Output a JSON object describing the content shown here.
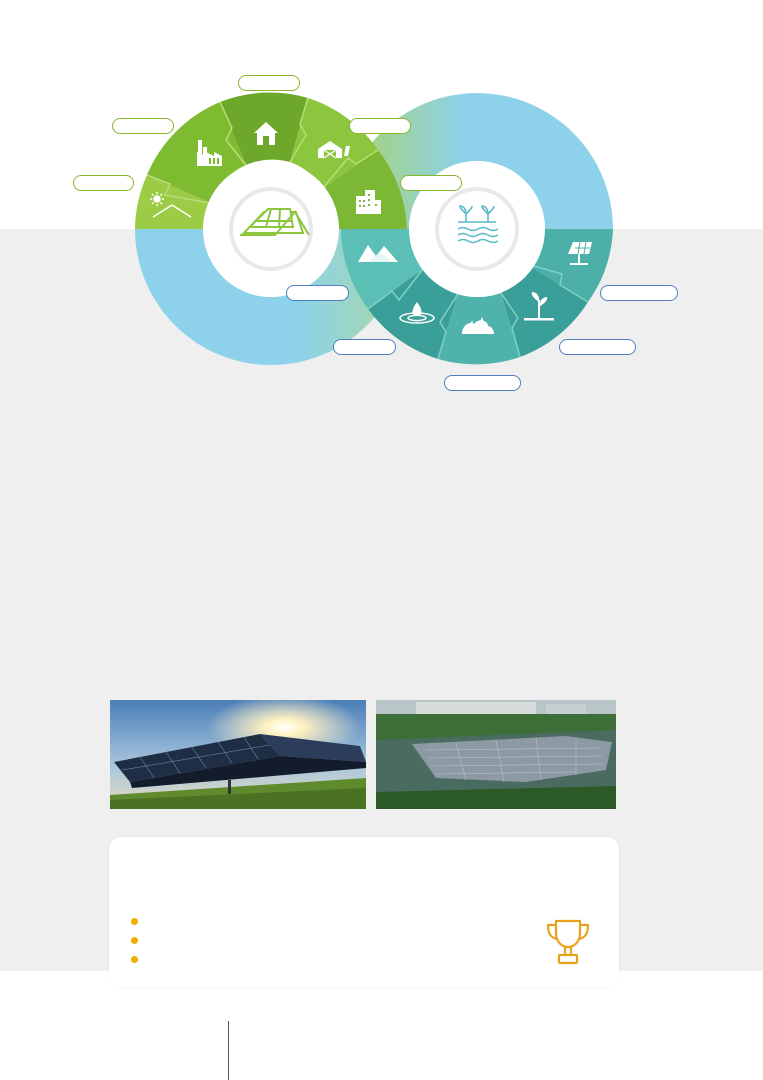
{
  "diagram": {
    "left_ring": {
      "center_icon": "rooftop-solar-panel-icon",
      "segments": [
        {
          "icon": "sun-roof-icon",
          "label": ""
        },
        {
          "icon": "factory-icon",
          "label": ""
        },
        {
          "icon": "house-icon",
          "label": ""
        },
        {
          "icon": "barn-icon",
          "label": ""
        },
        {
          "icon": "office-building-icon",
          "label": ""
        }
      ],
      "connector_label": ""
    },
    "right_ring": {
      "center_icon": "water-agriculture-icon",
      "segments": [
        {
          "icon": "mountains-icon",
          "label": ""
        },
        {
          "icon": "water-drop-icon",
          "label": ""
        },
        {
          "icon": "land-mound-icon",
          "label": ""
        },
        {
          "icon": "seedling-icon",
          "label": ""
        },
        {
          "icon": "ground-solar-panel-icon",
          "label": ""
        }
      ]
    },
    "colors": {
      "green": "#8cc63e",
      "dark_green": "#6ea82a",
      "teal": "#5bbfb5",
      "dark_teal": "#3a9f98",
      "light_blue": "#8dd2ea"
    }
  },
  "photos": [
    {
      "icon": "solar-farm-photo"
    },
    {
      "icon": "floating-solar-photo"
    }
  ],
  "card": {
    "title": "",
    "bullets": [
      "",
      "",
      ""
    ],
    "icon": "trophy-icon",
    "bullet_color": "#f0ad00"
  },
  "footer": {}
}
